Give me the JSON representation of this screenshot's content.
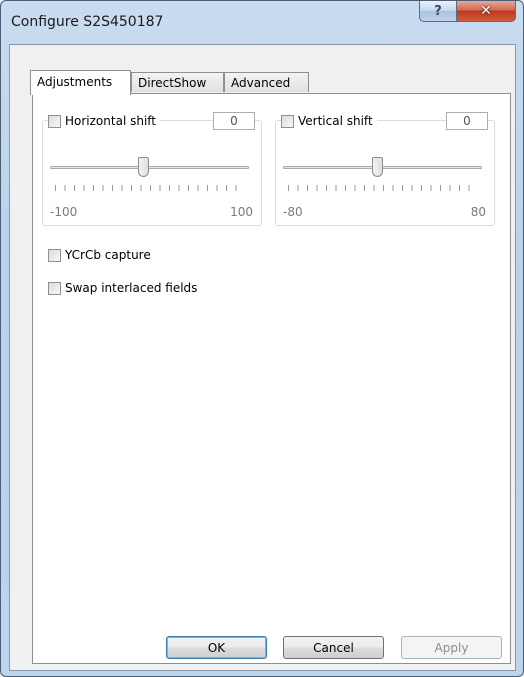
{
  "window": {
    "title": "Configure S2S450187"
  },
  "caption_buttons": {
    "help": "?",
    "close": "✕"
  },
  "tabs": [
    {
      "label": "Adjustments",
      "active": true
    },
    {
      "label": "DirectShow",
      "active": false
    },
    {
      "label": "Advanced",
      "active": false
    }
  ],
  "horizontal": {
    "label": "Horizontal shift",
    "value": "0",
    "min": "-100",
    "max": "100",
    "checked": false
  },
  "vertical": {
    "label": "Vertical shift",
    "value": "0",
    "min": "-80",
    "max": "80",
    "checked": false
  },
  "options": [
    {
      "label": "YCrCb capture",
      "checked": false
    },
    {
      "label": "Swap interlaced fields",
      "checked": false
    }
  ],
  "buttons": {
    "ok": "OK",
    "cancel": "Cancel",
    "apply": "Apply"
  },
  "colors": {
    "accent": "#3c7fb1",
    "close": "#c0381b"
  }
}
